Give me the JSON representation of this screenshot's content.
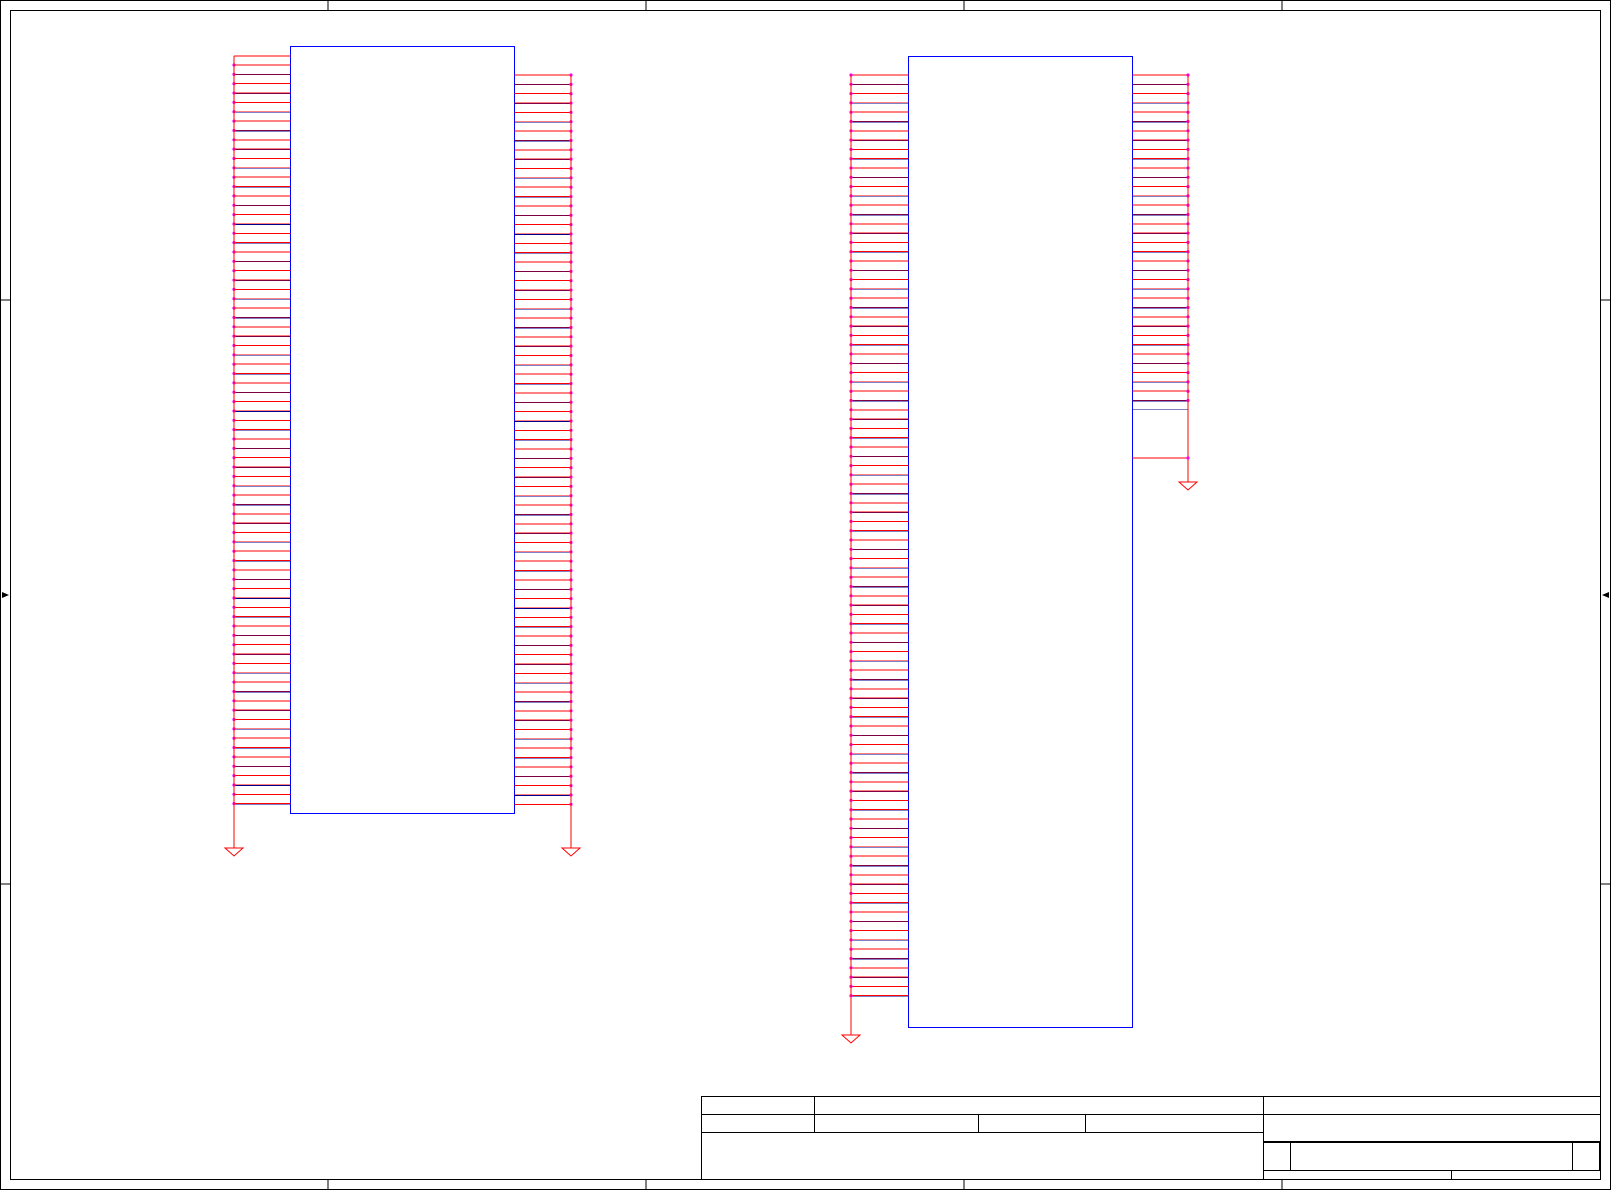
{
  "colors": {
    "frame": "#000000",
    "component_body": "#0000ff",
    "pin": "#ff0000",
    "wire": "#00008b",
    "junction": "#ff00ff",
    "ground": "#ff0000"
  },
  "components": [
    {
      "id": "connector-a",
      "left_pins": 80,
      "right_pins": 79,
      "has_left_ground": true,
      "has_right_ground": true
    },
    {
      "id": "connector-b",
      "left_pins": 100,
      "right_pins": 36,
      "has_left_ground": true,
      "has_right_ground": true
    }
  ],
  "title_block": {
    "present": true
  }
}
